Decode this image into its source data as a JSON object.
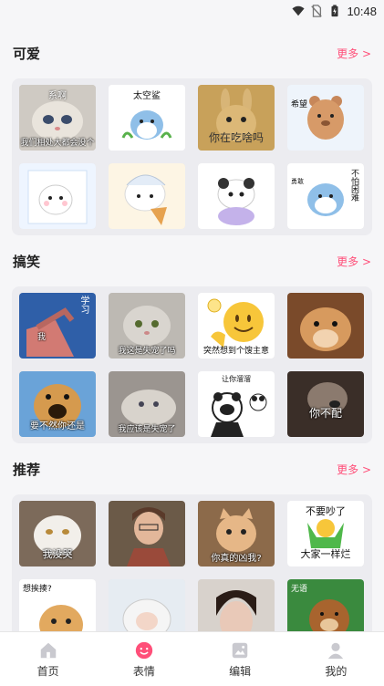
{
  "status_bar": {
    "time": "10:48",
    "icons": [
      "wifi-icon",
      "no-sim-icon",
      "battery-icon"
    ]
  },
  "sections": [
    {
      "title": "可爱",
      "more": "更多 >",
      "tiles": [
        {
          "icon": "cat-meme",
          "caption": "我们相处大都会没个",
          "top": "系啊"
        },
        {
          "icon": "shark-meme",
          "caption": "",
          "top": "太空鲨"
        },
        {
          "icon": "rabbit-meme",
          "caption": "你在吃啥吗",
          "top": ""
        },
        {
          "icon": "bear-meme",
          "caption": "",
          "top": "希望"
        },
        {
          "icon": "white-cat-meme",
          "caption": "",
          "top": ""
        },
        {
          "icon": "bunny-cone-meme",
          "caption": "",
          "top": ""
        },
        {
          "icon": "panda-meme",
          "caption": "",
          "top": ""
        },
        {
          "icon": "shark-meme-2",
          "caption": "",
          "top": "不怕困难"
        }
      ]
    },
    {
      "title": "搞笑",
      "more": "更多 >",
      "tiles": [
        {
          "icon": "study-meme",
          "caption": "我",
          "top": "学习"
        },
        {
          "icon": "gray-cat-meme",
          "caption": "我这是失宠了吗",
          "top": ""
        },
        {
          "icon": "emoji-meme",
          "caption": "突然想到个馊主意",
          "top": ""
        },
        {
          "icon": "hamster-meme",
          "caption": "",
          "top": ""
        },
        {
          "icon": "dog-meme",
          "caption": "要不然你还是",
          "top": ""
        },
        {
          "icon": "cat-lying-meme",
          "caption": "我应该是失宠了",
          "top": ""
        },
        {
          "icon": "panda-man-meme",
          "caption": "",
          "top": "让你溜溜"
        },
        {
          "icon": "dog-dark-meme",
          "caption": "你不配",
          "top": ""
        }
      ]
    },
    {
      "title": "推荐",
      "more": "更多 >",
      "tiles": [
        {
          "icon": "white-cat-pout-meme",
          "caption": "我没哭",
          "top": ""
        },
        {
          "icon": "old-lady-meme",
          "caption": "",
          "top": ""
        },
        {
          "icon": "orange-cat-meme",
          "caption": "你真的凶我?",
          "top": ""
        },
        {
          "icon": "cheer-meme",
          "caption": "大家一样烂",
          "top": "不要吵了"
        },
        {
          "icon": "cat-meme-4",
          "caption": "",
          "top": "想挨揍?"
        },
        {
          "icon": "sheep-meme",
          "caption": "",
          "top": ""
        },
        {
          "icon": "girl-meme",
          "caption": "",
          "top": ""
        },
        {
          "icon": "bear-cartoon-meme",
          "caption": "",
          "top": "无语"
        }
      ]
    }
  ],
  "nav": [
    {
      "label": "首页",
      "icon": "home-icon"
    },
    {
      "label": "表情",
      "icon": "emoji-icon"
    },
    {
      "label": "编辑",
      "icon": "edit-icon"
    },
    {
      "label": "我的",
      "icon": "profile-icon"
    }
  ],
  "colors": {
    "accent": "#ff4f79",
    "background": "#f6f6f8",
    "grid_bg": "#ececf0"
  }
}
